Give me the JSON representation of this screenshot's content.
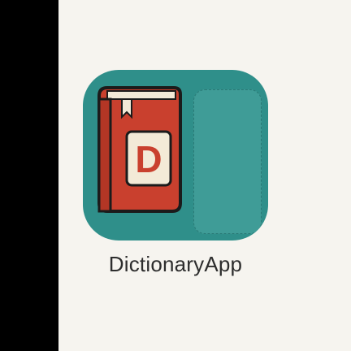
{
  "app": {
    "label": "DictionaryApp",
    "book_letter": "D"
  },
  "colors": {
    "page_bg": "#f6f4ef",
    "left_band": "#000000",
    "icon_bg": "#2f8f8a",
    "book_red": "#c9402e",
    "book_page": "#f3ead7",
    "label_text": "#2d2d2d"
  },
  "icons": {
    "app_icon": "dictionary-book-icon"
  }
}
